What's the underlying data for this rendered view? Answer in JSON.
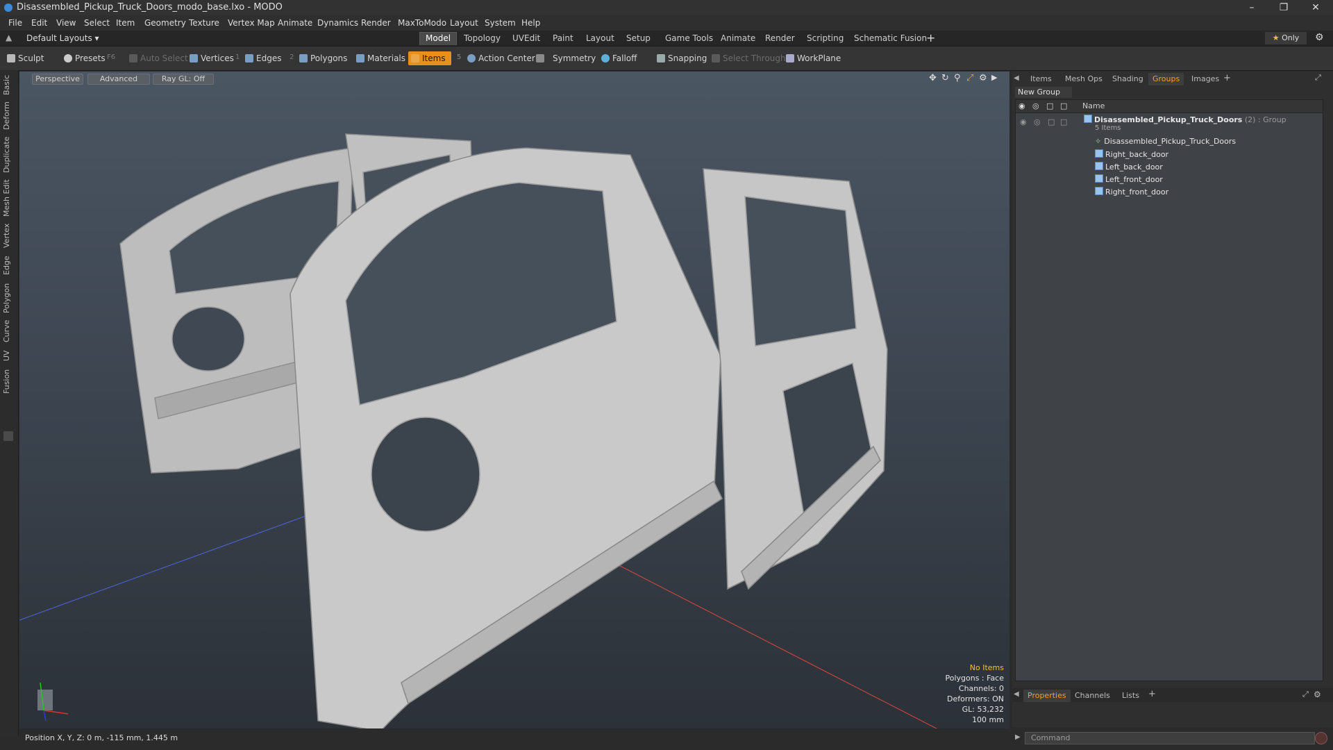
{
  "window": {
    "title": "Disassembled_Pickup_Truck_Doors_modo_base.lxo - MODO"
  },
  "menu": [
    "File",
    "Edit",
    "View",
    "Select",
    "Item",
    "Geometry",
    "Texture",
    "Vertex Map",
    "Animate",
    "Dynamics",
    "Render",
    "MaxToModo",
    "Layout",
    "System",
    "Help"
  ],
  "layout_selector": "Default Layouts",
  "mode_tabs": [
    "Model",
    "Topology",
    "UVEdit",
    "Paint",
    "Layout",
    "Setup",
    "Game Tools",
    "Animate",
    "Render",
    "Scripting",
    "Schematic Fusion"
  ],
  "active_mode_tab": "Model",
  "only_label": "Only",
  "toolbar": {
    "sculpt": "Sculpt",
    "presets": "Presets",
    "presets_key": "F6",
    "auto_select": "Auto Select",
    "vertices": "Vertices",
    "vertices_count": "1",
    "edges": "Edges",
    "edges_count": "2",
    "polygons": "Polygons",
    "materials": "Materials",
    "items": "Items",
    "items_count": "5",
    "action_center": "Action Center",
    "symmetry": "Symmetry",
    "falloff": "Falloff",
    "snapping": "Snapping",
    "select_through": "Select Through",
    "workplane": "WorkPlane"
  },
  "left_tabs": [
    "Basic",
    "Deform",
    "Duplicate",
    "Mesh Edit",
    "Vertex",
    "Edge",
    "Polygon",
    "Curve",
    "UV",
    "Fusion"
  ],
  "viewport": {
    "view_mode": "Perspective",
    "shading": "Advanced",
    "raygl": "Ray GL: Off",
    "info": {
      "selection": "No Items",
      "polygons": "Polygons : Face",
      "channels": "Channels: 0",
      "deformers": "Deformers: ON",
      "gl": "GL: 53,232",
      "scale": "100 mm"
    }
  },
  "status": {
    "position": "Position X, Y, Z:  0 m, -115 mm, 1.445 m"
  },
  "right_panel": {
    "tabs": [
      "Items",
      "Mesh Ops",
      "Shading",
      "Groups",
      "Images"
    ],
    "active_tab": "Groups",
    "new_group": "New Group",
    "name_header": "Name",
    "group": {
      "name": "Disassembled_Pickup_Truck_Doors",
      "count": "(2)",
      "type": ": Group",
      "sub": "5 Items"
    },
    "children": [
      "Disassembled_Pickup_Truck_Doors",
      "Right_back_door",
      "Left_back_door",
      "Left_front_door",
      "Right_front_door"
    ],
    "bottom_tabs": [
      "Properties",
      "Channels",
      "Lists"
    ],
    "active_bottom_tab": "Properties",
    "command_placeholder": "Command"
  },
  "colors": {
    "accent": "#e7901c",
    "active_tab_text": "#f0a030"
  }
}
